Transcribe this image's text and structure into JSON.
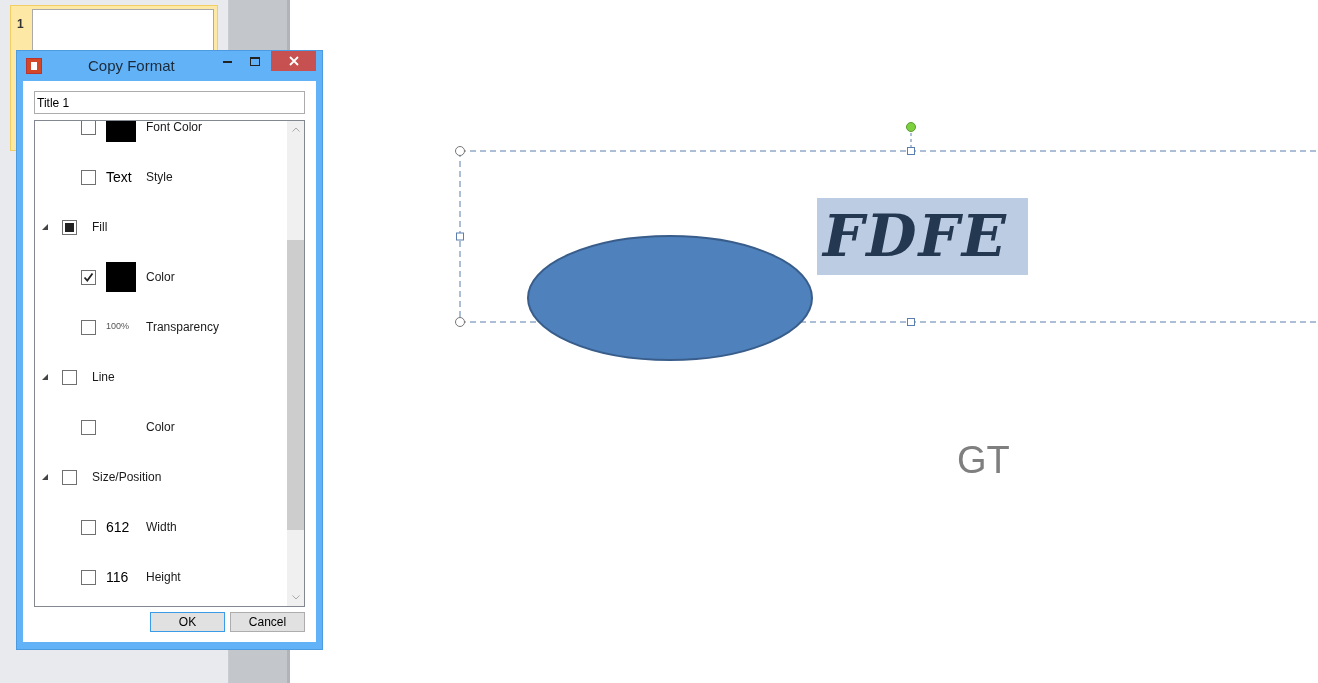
{
  "thumbnails": [
    {
      "number": "1",
      "selected": true
    }
  ],
  "dialog": {
    "title": "Copy Format",
    "name_field": {
      "value": "Title 1"
    },
    "tree": [
      {
        "children": [
          {
            "label": "Font Color",
            "checked": false,
            "preview": {
              "kind": "swatch",
              "color": "#000000"
            }
          },
          {
            "label": "Style",
            "checked": false,
            "preview": {
              "kind": "text",
              "text": "Text"
            }
          }
        ]
      },
      {
        "label": "Fill",
        "checked": false,
        "indeterminate": true,
        "expanded": true,
        "children": [
          {
            "label": "Color",
            "checked": true,
            "preview": {
              "kind": "swatch",
              "color": "#000000"
            }
          },
          {
            "label": "Transparency",
            "checked": false,
            "preview": {
              "kind": "small_text",
              "text": "100%"
            }
          }
        ]
      },
      {
        "label": "Line",
        "checked": false,
        "indeterminate": false,
        "expanded": true,
        "children": [
          {
            "label": "Color",
            "checked": false
          }
        ]
      },
      {
        "label": "Size/Position",
        "checked": false,
        "indeterminate": false,
        "expanded": true,
        "children": [
          {
            "label": "Width",
            "checked": false,
            "preview": {
              "kind": "text",
              "text": "612"
            }
          },
          {
            "label": "Height",
            "checked": false,
            "preview": {
              "kind": "text",
              "text": "116"
            }
          }
        ]
      }
    ],
    "buttons": [
      {
        "label": "OK",
        "default": true
      },
      {
        "label": "Cancel",
        "default": false
      }
    ]
  },
  "slide": {
    "title_text": "FDFE",
    "body_text": "GT"
  }
}
